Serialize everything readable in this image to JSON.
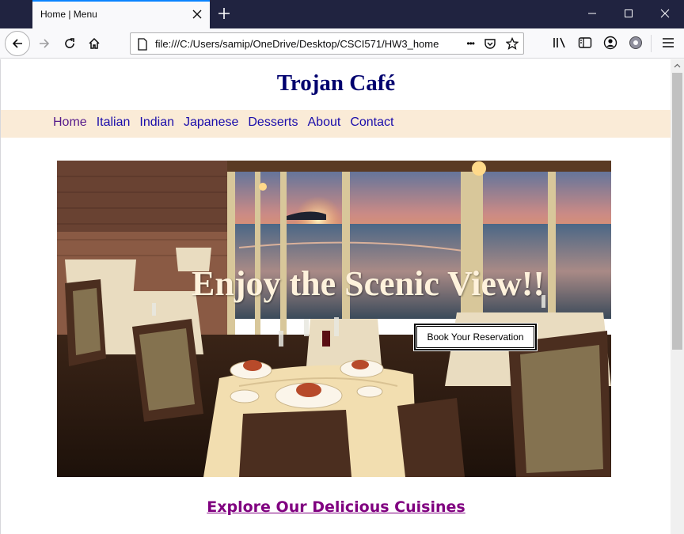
{
  "browser": {
    "tab_title": "Home | Menu",
    "url_path": "file:///C:/Users/samip/OneDrive/Desktop/CSCI571/HW3_home",
    "url_more": "•••"
  },
  "page": {
    "site_title": "Trojan Café",
    "nav": [
      {
        "label": "Home"
      },
      {
        "label": "Italian"
      },
      {
        "label": "Indian"
      },
      {
        "label": "Japanese"
      },
      {
        "label": "Desserts"
      },
      {
        "label": "About"
      },
      {
        "label": "Contact"
      }
    ],
    "hero": {
      "headline": "Enjoy the Scenic View!!",
      "button_label": "Book Your Reservation"
    },
    "explore_heading": "Explore Our Delicious Cuisines"
  },
  "colors": {
    "title": "#00006e",
    "nav_background": "#faebd7",
    "link": "#1a0dab",
    "visited_link": "#551a8b",
    "explore": "#800080",
    "tab_accent": "#0a84ff",
    "tabbar": "#202340"
  },
  "icons": [
    "back-icon",
    "forward-icon",
    "reload-icon",
    "home-icon",
    "page-icon",
    "more-icon",
    "pocket-icon",
    "bookmark-star-icon",
    "library-icon",
    "sidebar-icon",
    "account-icon",
    "extensions-icon",
    "menu-icon",
    "close-icon",
    "plus-icon",
    "minimize-icon",
    "maximize-icon"
  ]
}
